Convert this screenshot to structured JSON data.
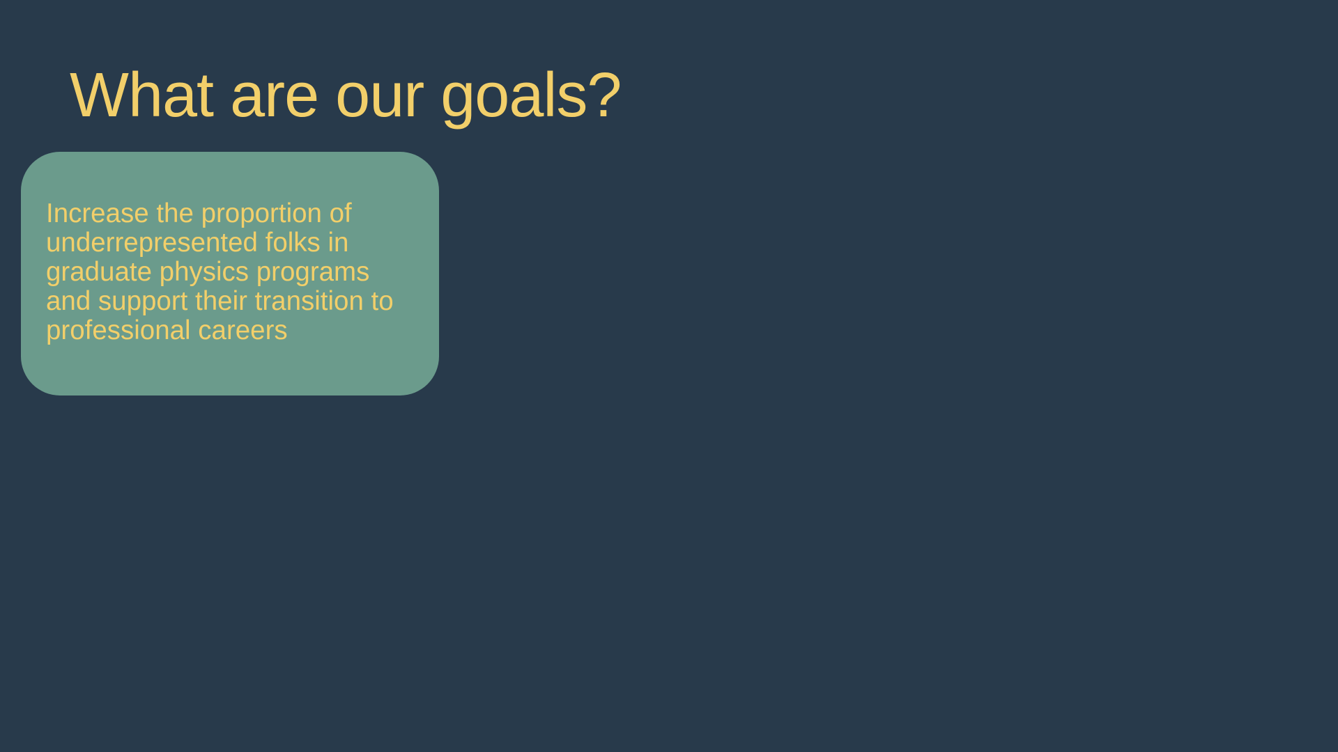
{
  "slide": {
    "title": "What are our goals?",
    "goal_card": {
      "text": "Increase the proportion of\nunderrepresented folks in\ngraduate physics programs\nand support their transition to\nprofessional careers"
    }
  },
  "colors": {
    "background": "#283a4b",
    "card": "#6b9b8c",
    "text": "#f2cf6a"
  }
}
